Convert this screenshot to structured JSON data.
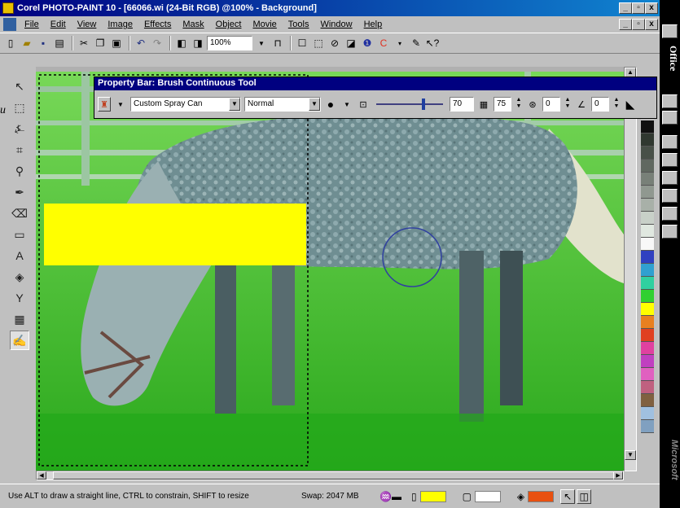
{
  "window": {
    "title": "Corel PHOTO-PAINT 10 - [66066.wi (24-Bit RGB) @100% - Background]",
    "min_label": "_",
    "max_label": "▫",
    "close_label": "x"
  },
  "menu": [
    {
      "label": "File"
    },
    {
      "label": "Edit"
    },
    {
      "label": "View"
    },
    {
      "label": "Image"
    },
    {
      "label": "Effects"
    },
    {
      "label": "Mask"
    },
    {
      "label": "Object"
    },
    {
      "label": "Movie"
    },
    {
      "label": "Tools"
    },
    {
      "label": "Window"
    },
    {
      "label": "Help"
    }
  ],
  "toolbar": {
    "zoom": "100%",
    "icons": [
      "new-icon",
      "open-icon",
      "save-icon",
      "print-icon",
      "cut-icon",
      "copy-icon",
      "paste-icon",
      "undo-icon",
      "redo-icon",
      "import-icon",
      "export-icon"
    ]
  },
  "property_bar": {
    "title": "Property Bar: Brush Continuous Tool",
    "brush_type": "Custom Spray Can",
    "merge_mode": "Normal",
    "size": "70",
    "transparency": "75",
    "rotate": "0",
    "flatten": "0"
  },
  "stray_text": "u",
  "status": {
    "hint": "Use ALT to draw a straight line, CTRL to constrain, SHIFT to resize",
    "swap": "Swap: 2047 MB"
  },
  "side_strip": {
    "office_label": "Office",
    "brand_label": "Microsoft"
  },
  "colors": {
    "paint": "#ffff00",
    "paper": "#ffffff",
    "fill": "#e85010",
    "grass": "#4cc236"
  },
  "palette": [
    "#101010",
    "#303830",
    "#485048",
    "#606860",
    "#788078",
    "#909890",
    "#a8b0a8",
    "#c8d0c8",
    "#e0e8e0",
    "#f8f8f8",
    "#3040c0",
    "#30a0d0",
    "#30d0a0",
    "#30d030",
    "#ffff00",
    "#e88020",
    "#e04020",
    "#e040a0",
    "#c040c0",
    "#e060c0",
    "#c06080",
    "#806040",
    "#a0c0e0",
    "#80a0c0"
  ]
}
